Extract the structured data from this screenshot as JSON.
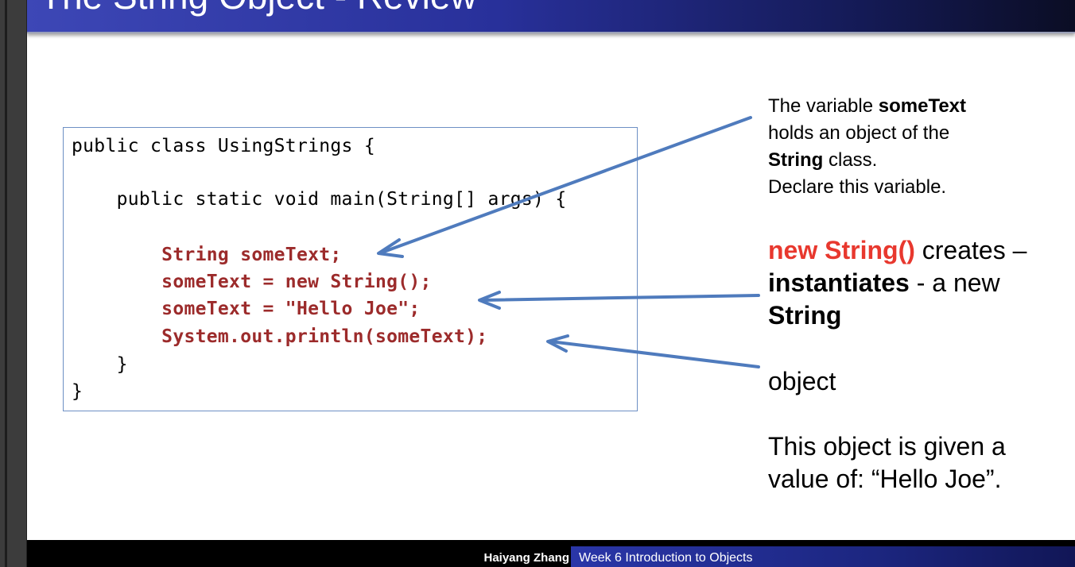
{
  "slide": {
    "title": "The String Object - Review",
    "code_lines": [
      "public class UsingStrings {",
      "    public static void main(String[] args) {",
      "        String someText;",
      "        someText = new String();",
      "        someText = \"Hello Joe\";",
      "        System.out.println(someText);",
      "    }",
      "}"
    ],
    "note1": {
      "line1_pre": "The variable ",
      "line1_bold": "someText",
      "line2": "holds an object of the",
      "line3_bold": "String",
      "line3_post": " class.",
      "line4": "Declare this variable."
    },
    "note2": {
      "line1_red": "new String()",
      "line1_post": " creates –",
      "line2_bold": "instantiates",
      "line2_post": " - a new",
      "line3_bold": "String"
    },
    "note3": {
      "word": "object",
      "line1": "This object is given a",
      "line2": "value of: “Hello Joe”."
    }
  },
  "footer": {
    "author": "Haiyang Zhang",
    "course": "Week 6 Introduction to Objects"
  },
  "colors": {
    "title_bar": "#28309a",
    "code_highlight": "#9c2b2b",
    "accent_red": "#e8382e",
    "arrow": "#4f7bbd"
  }
}
